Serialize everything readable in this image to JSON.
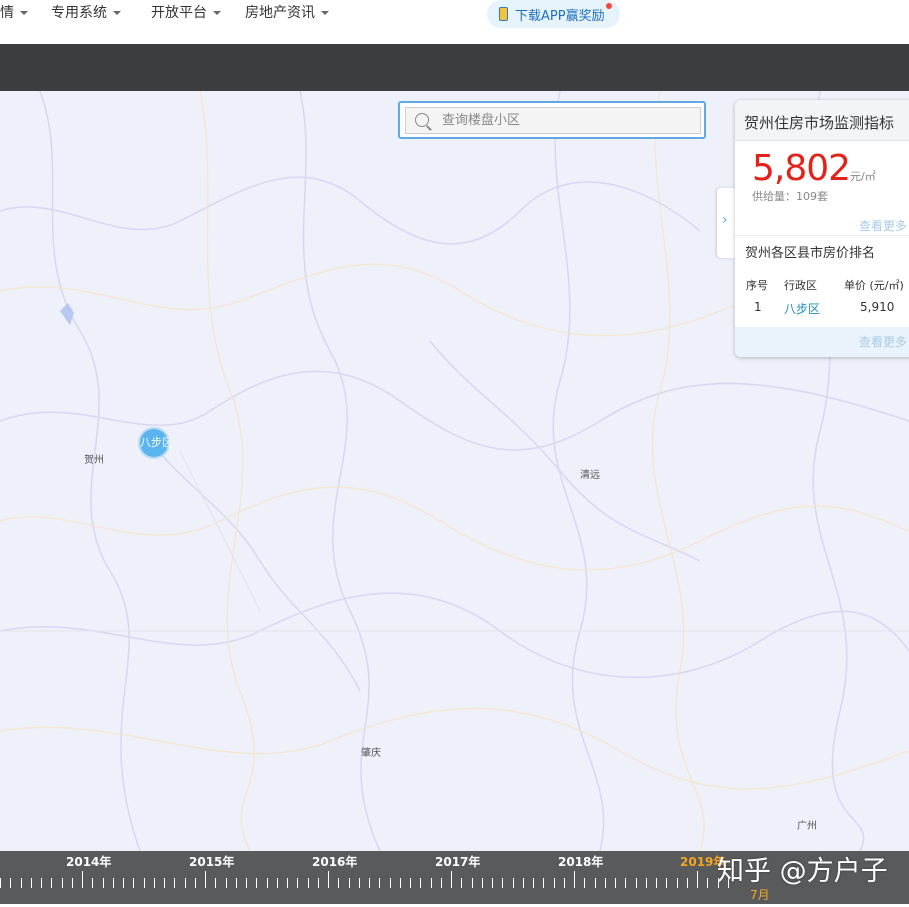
{
  "nav": {
    "items": [
      "情",
      "专用系统",
      "开放平台",
      "房地产资讯"
    ],
    "app_button": "下载APP赢奖励"
  },
  "search": {
    "placeholder": "查询楼盘小区"
  },
  "map": {
    "cities": [
      "贺州",
      "清远",
      "肇庆",
      "广州"
    ],
    "cluster_label": "八步区"
  },
  "panel": {
    "title": "贺州住房市场监测指标",
    "price": "5,802",
    "price_unit": "元/㎡",
    "supply": "供给量：109套",
    "more_label": "查看更多",
    "ranking_title": "贺州各区县市房价排名",
    "columns": [
      "序号",
      "行政区",
      "单价 (元/㎡)"
    ],
    "rows": [
      {
        "rank": "1",
        "district": "八步区",
        "price": "5,910"
      }
    ],
    "more_label_2": "查看更多",
    "toggle": "›"
  },
  "timeline": {
    "years": [
      "2014年",
      "2015年",
      "2016年",
      "2017年",
      "2018年",
      "2019年"
    ],
    "active_month": "7月"
  },
  "watermark": "知乎 @方户子",
  "colors": {
    "price": "#e2231a",
    "accent": "#5ea9e4",
    "timeline_active": "#f5a623"
  }
}
